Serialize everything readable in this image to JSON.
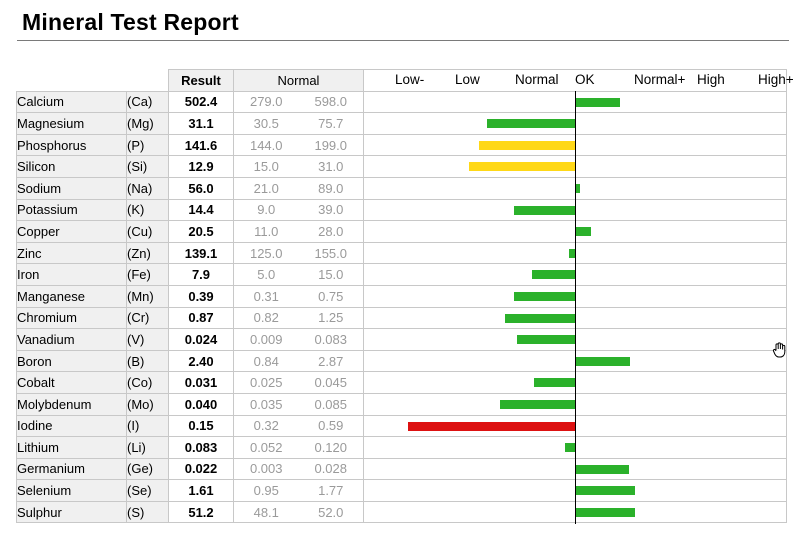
{
  "page_title": "Mineral Test Report",
  "header": {
    "result": "Result",
    "normal": "Normal",
    "scale": [
      "Low-",
      "Low",
      "Normal",
      "OK",
      "Normal+",
      "High",
      "High+"
    ]
  },
  "colors": {
    "green": "#2bb12b",
    "yellow": "#ffd817",
    "red": "#dd1111"
  },
  "rows": [
    {
      "name": "Calcium",
      "symbol": "(Ca)",
      "result": "502.4",
      "low": "279.0",
      "high": "598.0"
    },
    {
      "name": "Magnesium",
      "symbol": "(Mg)",
      "result": "31.1",
      "low": "30.5",
      "high": "75.7"
    },
    {
      "name": "Phosphorus",
      "symbol": "(P)",
      "result": "141.6",
      "low": "144.0",
      "high": "199.0"
    },
    {
      "name": "Silicon",
      "symbol": "(Si)",
      "result": "12.9",
      "low": "15.0",
      "high": "31.0"
    },
    {
      "name": "Sodium",
      "symbol": "(Na)",
      "result": "56.0",
      "low": "21.0",
      "high": "89.0"
    },
    {
      "name": "Potassium",
      "symbol": "(K)",
      "result": "14.4",
      "low": "9.0",
      "high": "39.0"
    },
    {
      "name": "Copper",
      "symbol": "(Cu)",
      "result": "20.5",
      "low": "11.0",
      "high": "28.0"
    },
    {
      "name": "Zinc",
      "symbol": "(Zn)",
      "result": "139.1",
      "low": "125.0",
      "high": "155.0"
    },
    {
      "name": "Iron",
      "symbol": "(Fe)",
      "result": "7.9",
      "low": "5.0",
      "high": "15.0"
    },
    {
      "name": "Manganese",
      "symbol": "(Mn)",
      "result": "0.39",
      "low": "0.31",
      "high": "0.75"
    },
    {
      "name": "Chromium",
      "symbol": "(Cr)",
      "result": "0.87",
      "low": "0.82",
      "high": "1.25"
    },
    {
      "name": "Vanadium",
      "symbol": "(V)",
      "result": "0.024",
      "low": "0.009",
      "high": "0.083"
    },
    {
      "name": "Boron",
      "symbol": "(B)",
      "result": "2.40",
      "low": "0.84",
      "high": "2.87"
    },
    {
      "name": "Cobalt",
      "symbol": "(Co)",
      "result": "0.031",
      "low": "0.025",
      "high": "0.045"
    },
    {
      "name": "Molybdenum",
      "symbol": "(Mo)",
      "result": "0.040",
      "low": "0.035",
      "high": "0.085"
    },
    {
      "name": "Iodine",
      "symbol": "(I)",
      "result": "0.15",
      "low": "0.32",
      "high": "0.59"
    },
    {
      "name": "Lithium",
      "symbol": "(Li)",
      "result": "0.083",
      "low": "0.052",
      "high": "0.120"
    },
    {
      "name": "Germanium",
      "symbol": "(Ge)",
      "result": "0.022",
      "low": "0.003",
      "high": "0.028"
    },
    {
      "name": "Selenium",
      "symbol": "(Se)",
      "result": "1.61",
      "low": "0.95",
      "high": "1.77"
    },
    {
      "name": "Sulphur",
      "symbol": "(S)",
      "result": "51.2",
      "low": "48.1",
      "high": "52.0"
    }
  ],
  "chart_data": {
    "type": "bar",
    "orientation": "horizontal",
    "baseline": "OK",
    "scale_labels": [
      "Low-",
      "Low",
      "Normal",
      "OK",
      "Normal+",
      "High",
      "High+"
    ],
    "xlim": [
      -3.5,
      3.5
    ],
    "categories": [
      "Calcium",
      "Magnesium",
      "Phosphorus",
      "Silicon",
      "Sodium",
      "Potassium",
      "Copper",
      "Zinc",
      "Iron",
      "Manganese",
      "Chromium",
      "Vanadium",
      "Boron",
      "Cobalt",
      "Molybdenum",
      "Iodine",
      "Lithium",
      "Germanium",
      "Selenium",
      "Sulphur"
    ],
    "values": [
      0.72,
      -1.47,
      -1.6,
      -1.77,
      0.07,
      -1.03,
      0.25,
      -0.12,
      -0.73,
      -1.02,
      -1.18,
      -0.97,
      0.9,
      -0.7,
      -1.25,
      -2.77,
      -0.18,
      0.87,
      0.98,
      0.97
    ],
    "bar_colors": [
      "green",
      "green",
      "yellow",
      "yellow",
      "green",
      "green",
      "green",
      "green",
      "green",
      "green",
      "green",
      "green",
      "green",
      "green",
      "green",
      "red",
      "green",
      "green",
      "green",
      "green"
    ]
  }
}
